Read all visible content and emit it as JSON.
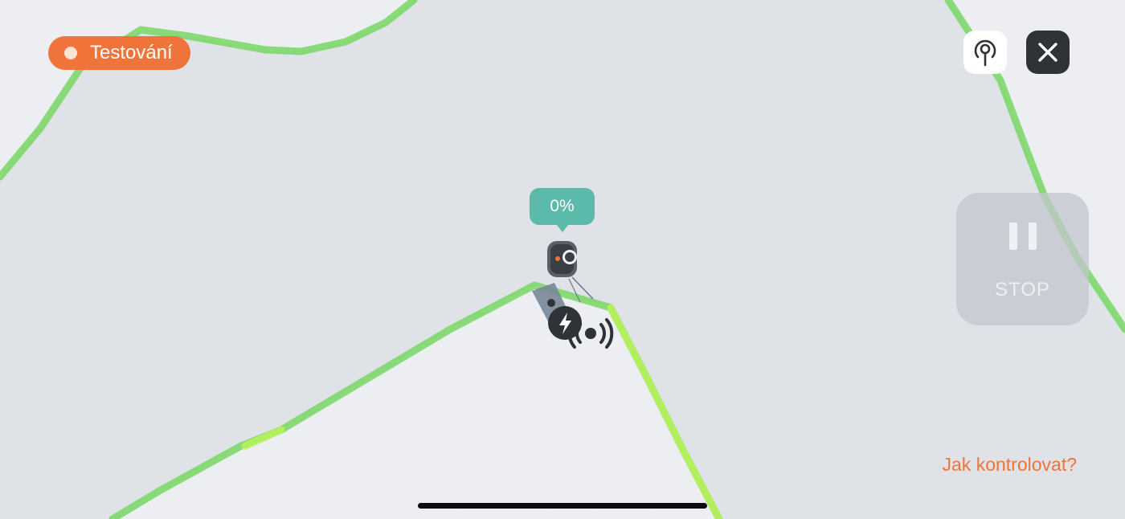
{
  "status": {
    "label": "Testování",
    "color": "#f0743a"
  },
  "robot": {
    "progress_label": "0%"
  },
  "controls": {
    "signal_icon": "signal-antenna-icon",
    "close_icon": "close-icon",
    "stop_label": "STOP",
    "stop_icon": "pause-icon"
  },
  "help": {
    "link_label": "Jak kontrolovat?"
  },
  "colors": {
    "boundary": "#7dd86a",
    "accent": "#f0743a",
    "progress": "#5cbaaa",
    "map_background": "#e4e7ec"
  }
}
